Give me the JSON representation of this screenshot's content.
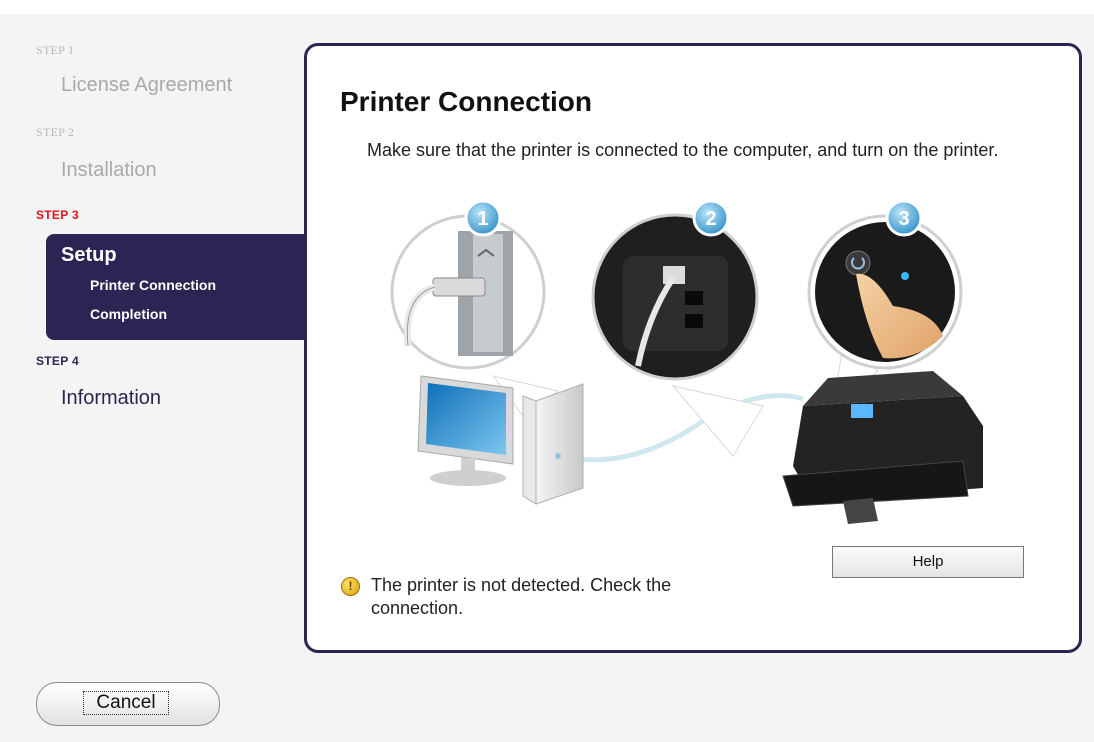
{
  "sidebar": {
    "step1": {
      "label": "STEP 1",
      "title": "License Agreement"
    },
    "step2": {
      "label": "STEP 2",
      "title": "Installation"
    },
    "step3": {
      "label": "STEP 3",
      "title": "Setup",
      "items": [
        "Printer Connection",
        "Completion"
      ]
    },
    "step4": {
      "label": "STEP 4",
      "title": "Information"
    }
  },
  "main": {
    "title": "Printer Connection",
    "description": "Make sure that the printer is connected to the computer, and turn on the printer.",
    "steps": [
      "1",
      "2",
      "3"
    ],
    "help_label": "Help",
    "warning_text": "The printer is not detected. Check the connection."
  },
  "footer": {
    "cancel_label": "Cancel"
  },
  "colors": {
    "accent": "#2b2553",
    "active_step": "#e0141a",
    "badge": "#4aa8d8"
  }
}
